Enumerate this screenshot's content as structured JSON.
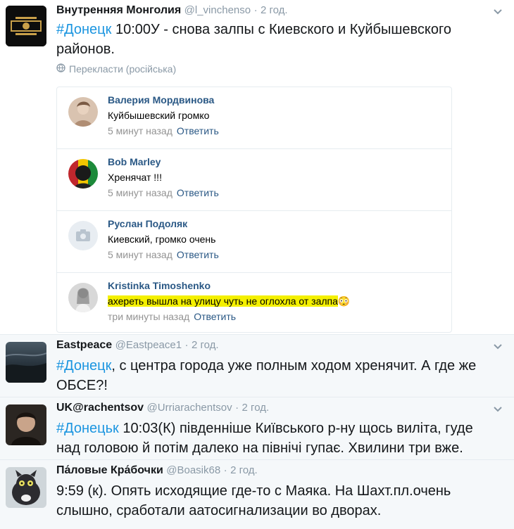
{
  "tweets": [
    {
      "name": "Внутренняя Монголия",
      "handle": "@l_vinchenso",
      "sep": "·",
      "time": "2 год.",
      "hashtag": "#Донецк",
      "text": " 10:00У - снова залпы с Киевского и Куйбышевского районов.",
      "translate": "Перекласти (російська)"
    },
    {
      "name": "Eastpeace",
      "handle": "@Eastpeace1",
      "sep": "·",
      "time": "2 год.",
      "hashtag": "#Донецк",
      "text": ", с центра города уже полным ходом  хренячит. А где же ОБСЕ?!"
    },
    {
      "name": "UK@rachentsov",
      "handle": "@Urriarachentsov",
      "sep": "·",
      "time": "2 год.",
      "hashtag": "#Донецьк",
      "text": " 10:03(К) південніше Київського р-ну щось виліта, гуде над головою й потім далеко на північі гупає. Хвилини три вже."
    },
    {
      "name": "Па́ловые Кра́бочки",
      "handle": "@Boasik68",
      "sep": "·",
      "time": "2 год.",
      "text": "9:59 (к). Опять исходящие где-то с Маяка. На Шахт.пл.очень слышно, сработали аатосигнализации во дворах."
    }
  ],
  "comments": [
    {
      "name": "Валерия Мордвинова",
      "text": "Куйбышевский громко",
      "time": "5 минут назад",
      "reply": "Ответить"
    },
    {
      "name": "Bob Marley",
      "text": "Хренячат !!!",
      "time": "5 минут назад",
      "reply": "Ответить"
    },
    {
      "name": "Руслан Подоляк",
      "text": "Киевский, громко очень",
      "time": "5 минут назад",
      "reply": "Ответить"
    },
    {
      "name": "Kristinka Timoshenko",
      "text": "ахереть вышла на улицу чуть не оглохла от залпа",
      "time": "три минуты назад",
      "reply": "Ответить",
      "emoji": "😳"
    }
  ],
  "icons": {
    "chevron": "chevron-down-icon",
    "globe": "globe-icon",
    "camera": "camera-icon"
  },
  "colors": {
    "link": "#1b95e0",
    "vk_link": "#2a5885",
    "highlight": "#f4f000"
  }
}
